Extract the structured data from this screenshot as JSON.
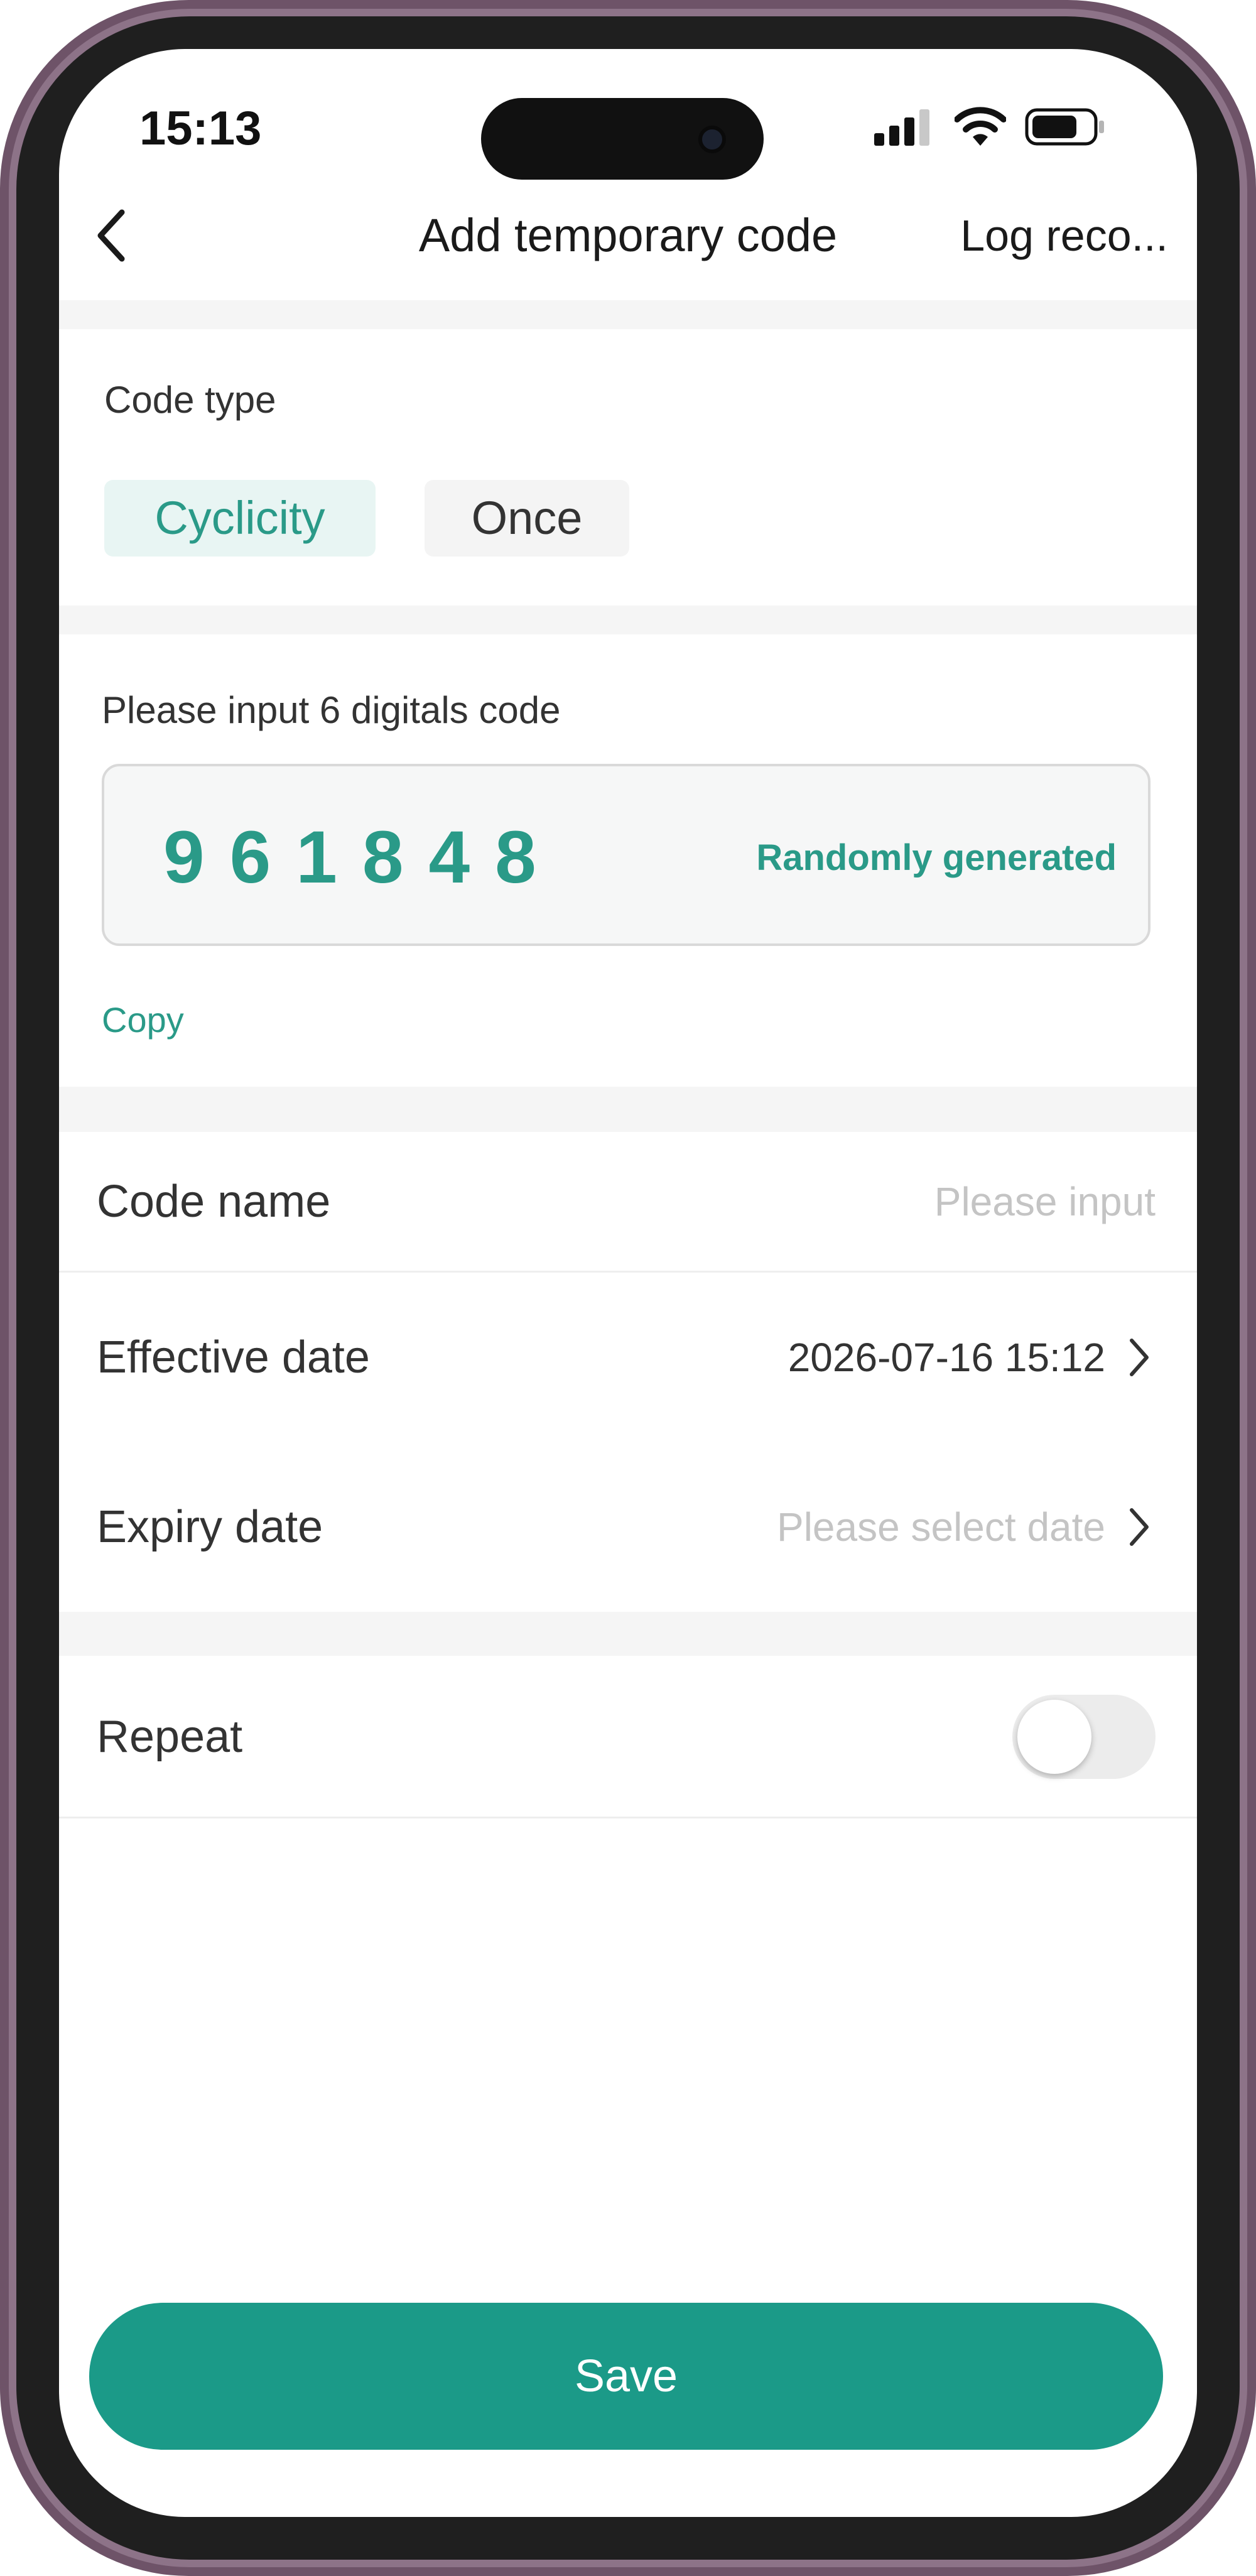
{
  "status_bar": {
    "time": "15:13"
  },
  "nav": {
    "title": "Add temporary code",
    "right_action": "Log reco..."
  },
  "code_type": {
    "label": "Code type",
    "options": [
      {
        "label": "Cyclicity",
        "selected": true
      },
      {
        "label": "Once",
        "selected": false
      }
    ]
  },
  "code": {
    "label": "Please input 6 digitals code",
    "value": "961848",
    "random_label": "Randomly generated",
    "copy_label": "Copy"
  },
  "form": {
    "code_name": {
      "label": "Code name",
      "placeholder": "Please input"
    },
    "effective_date": {
      "label": "Effective date",
      "value": "2026-07-16 15:12"
    },
    "expiry_date": {
      "label": "Expiry date",
      "placeholder": "Please select date"
    },
    "repeat": {
      "label": "Repeat",
      "enabled": false
    }
  },
  "actions": {
    "save_label": "Save"
  },
  "colors": {
    "accent": "#1b9a88",
    "accent_text": "#2a9a88",
    "chip_active_bg": "#e8f5f3"
  }
}
